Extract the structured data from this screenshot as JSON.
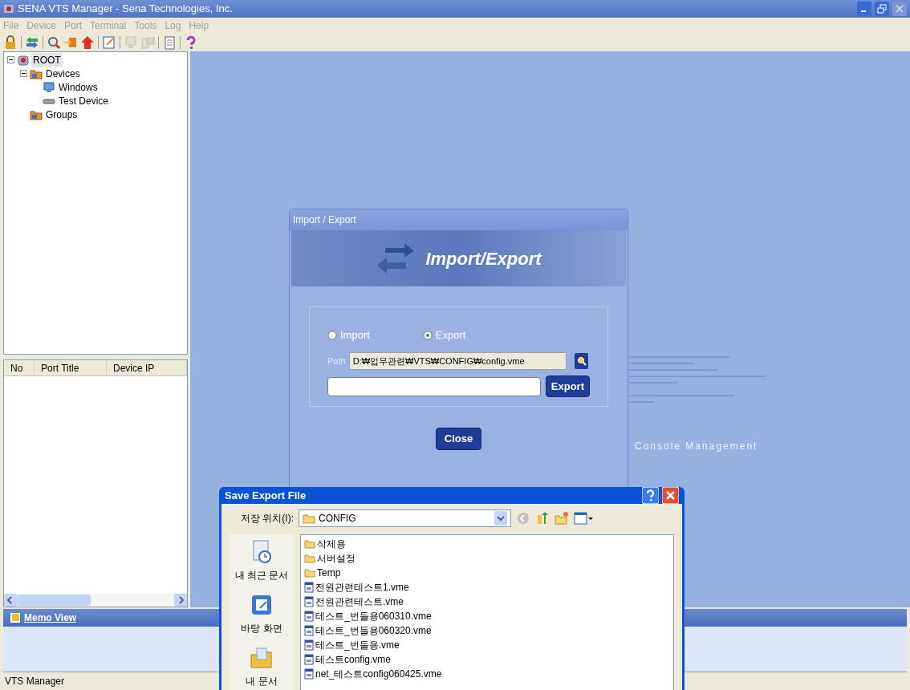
{
  "window": {
    "title": "SENA VTS Manager - Sena Technologies, Inc."
  },
  "menu": [
    {
      "label": "File"
    },
    {
      "label": "Device"
    },
    {
      "label": "Port"
    },
    {
      "label": "Terminal"
    },
    {
      "label": "Tools"
    },
    {
      "label": "Log"
    },
    {
      "label": "Help"
    }
  ],
  "toolbar": [
    {
      "kind": "lock",
      "disabled": false
    },
    {
      "kind": "sep"
    },
    {
      "kind": "arrows",
      "disabled": false
    },
    {
      "kind": "sep"
    },
    {
      "kind": "search",
      "disabled": false
    },
    {
      "kind": "import",
      "disabled": false
    },
    {
      "kind": "upload",
      "disabled": false
    },
    {
      "kind": "sep"
    },
    {
      "kind": "edit",
      "disabled": false
    },
    {
      "kind": "sep"
    },
    {
      "kind": "monitor",
      "disabled": true
    },
    {
      "kind": "computer",
      "disabled": true
    },
    {
      "kind": "sep"
    },
    {
      "kind": "document",
      "disabled": false
    },
    {
      "kind": "sep"
    },
    {
      "kind": "help",
      "disabled": false
    }
  ],
  "tree": [
    {
      "label": "ROOT",
      "kind": "root",
      "selected": true,
      "expanded": true,
      "children": [
        {
          "label": "Devices",
          "kind": "folder",
          "selected": false,
          "expanded": true,
          "children": [
            {
              "label": "Windows",
              "kind": "windows",
              "selected": false
            },
            {
              "label": "Test Device",
              "kind": "device",
              "selected": false
            }
          ]
        },
        {
          "label": "Groups",
          "kind": "folder",
          "selected": false
        }
      ]
    }
  ],
  "port_list": {
    "columns": [
      "No",
      "Port Title",
      "Device IP"
    ]
  },
  "memo_view": {
    "title": "Memo View"
  },
  "status_bar": "VTS Manager",
  "background_caption": "Console Management",
  "import_export_dialog": {
    "title": "Import / Export",
    "banner": "Import/Export",
    "options": [
      {
        "label": "Import",
        "selected": false
      },
      {
        "label": "Export",
        "selected": true
      }
    ],
    "path_label": "Path",
    "path_value": "D:₩업무관련₩VTS₩CONFIG₩config.vme",
    "export_button": "Export",
    "close_button": "Close"
  },
  "save_dialog": {
    "title": "Save Export File",
    "location_label": "저장 위치(I):",
    "location_value": "CONFIG",
    "places": [
      {
        "label": "내 최근 문서",
        "kind": "recent"
      },
      {
        "label": "바탕 화면",
        "kind": "desktop"
      },
      {
        "label": "내 문서",
        "kind": "documents"
      }
    ],
    "files": [
      {
        "name": "삭제용",
        "kind": "folder"
      },
      {
        "name": "서버설정",
        "kind": "folder"
      },
      {
        "name": "Temp",
        "kind": "folder"
      },
      {
        "name": "전원관련테스트1.vme",
        "kind": "file"
      },
      {
        "name": "전원관련테스트.vme",
        "kind": "file"
      },
      {
        "name": "테스트_번들용060310.vme",
        "kind": "file"
      },
      {
        "name": "테스트_번들용060320.vme",
        "kind": "file"
      },
      {
        "name": "테스트_번들용.vme",
        "kind": "file"
      },
      {
        "name": "테스트config.vme",
        "kind": "file"
      },
      {
        "name": "net_테스트config060425.vme",
        "kind": "file"
      }
    ]
  }
}
